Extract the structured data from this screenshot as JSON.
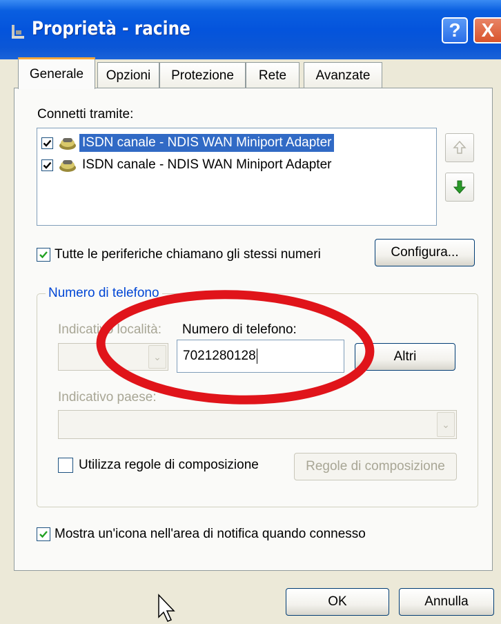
{
  "window": {
    "title": "Proprietà - racine",
    "help_label": "?",
    "close_label": "X",
    "titlebar_color": "#0454dc"
  },
  "tabs": [
    {
      "label": "Generale",
      "active": true
    },
    {
      "label": "Opzioni",
      "active": false
    },
    {
      "label": "Protezione",
      "active": false
    },
    {
      "label": "Rete",
      "active": false
    },
    {
      "label": "Avanzate",
      "active": false
    }
  ],
  "connect": {
    "label": "Connetti tramite:",
    "devices": [
      {
        "label": "ISDN  canale  - NDIS WAN Miniport Adapter",
        "checked": true,
        "selected": true
      },
      {
        "label": "ISDN  canale  - NDIS WAN Miniport Adapter",
        "checked": true,
        "selected": false
      }
    ],
    "move_up_icon": "arrow-up-icon",
    "move_down_icon": "arrow-down-icon"
  },
  "same_numbers": {
    "label": "Tutte le periferiche chiamano gli stessi numeri",
    "checked": true,
    "configure_label": "Configura..."
  },
  "phone_group": {
    "title": "Numero di telefono",
    "area_code_label": "Indicativo località:",
    "number_label": "Numero di telefono:",
    "number_value": "7021280128",
    "others_label": "Altri",
    "country_label": "Indicativo paese:",
    "dialing_rules_label": "Utilizza regole di composizione",
    "dialing_rules_checked": false,
    "dialing_rules_button": "Regole di composizione"
  },
  "notify": {
    "label": "Mostra un'icona nell'area di notifica quando connesso",
    "checked": true
  },
  "footer": {
    "ok_label": "OK",
    "cancel_label": "Annulla"
  },
  "annotation": {
    "color": "#e0141a"
  }
}
